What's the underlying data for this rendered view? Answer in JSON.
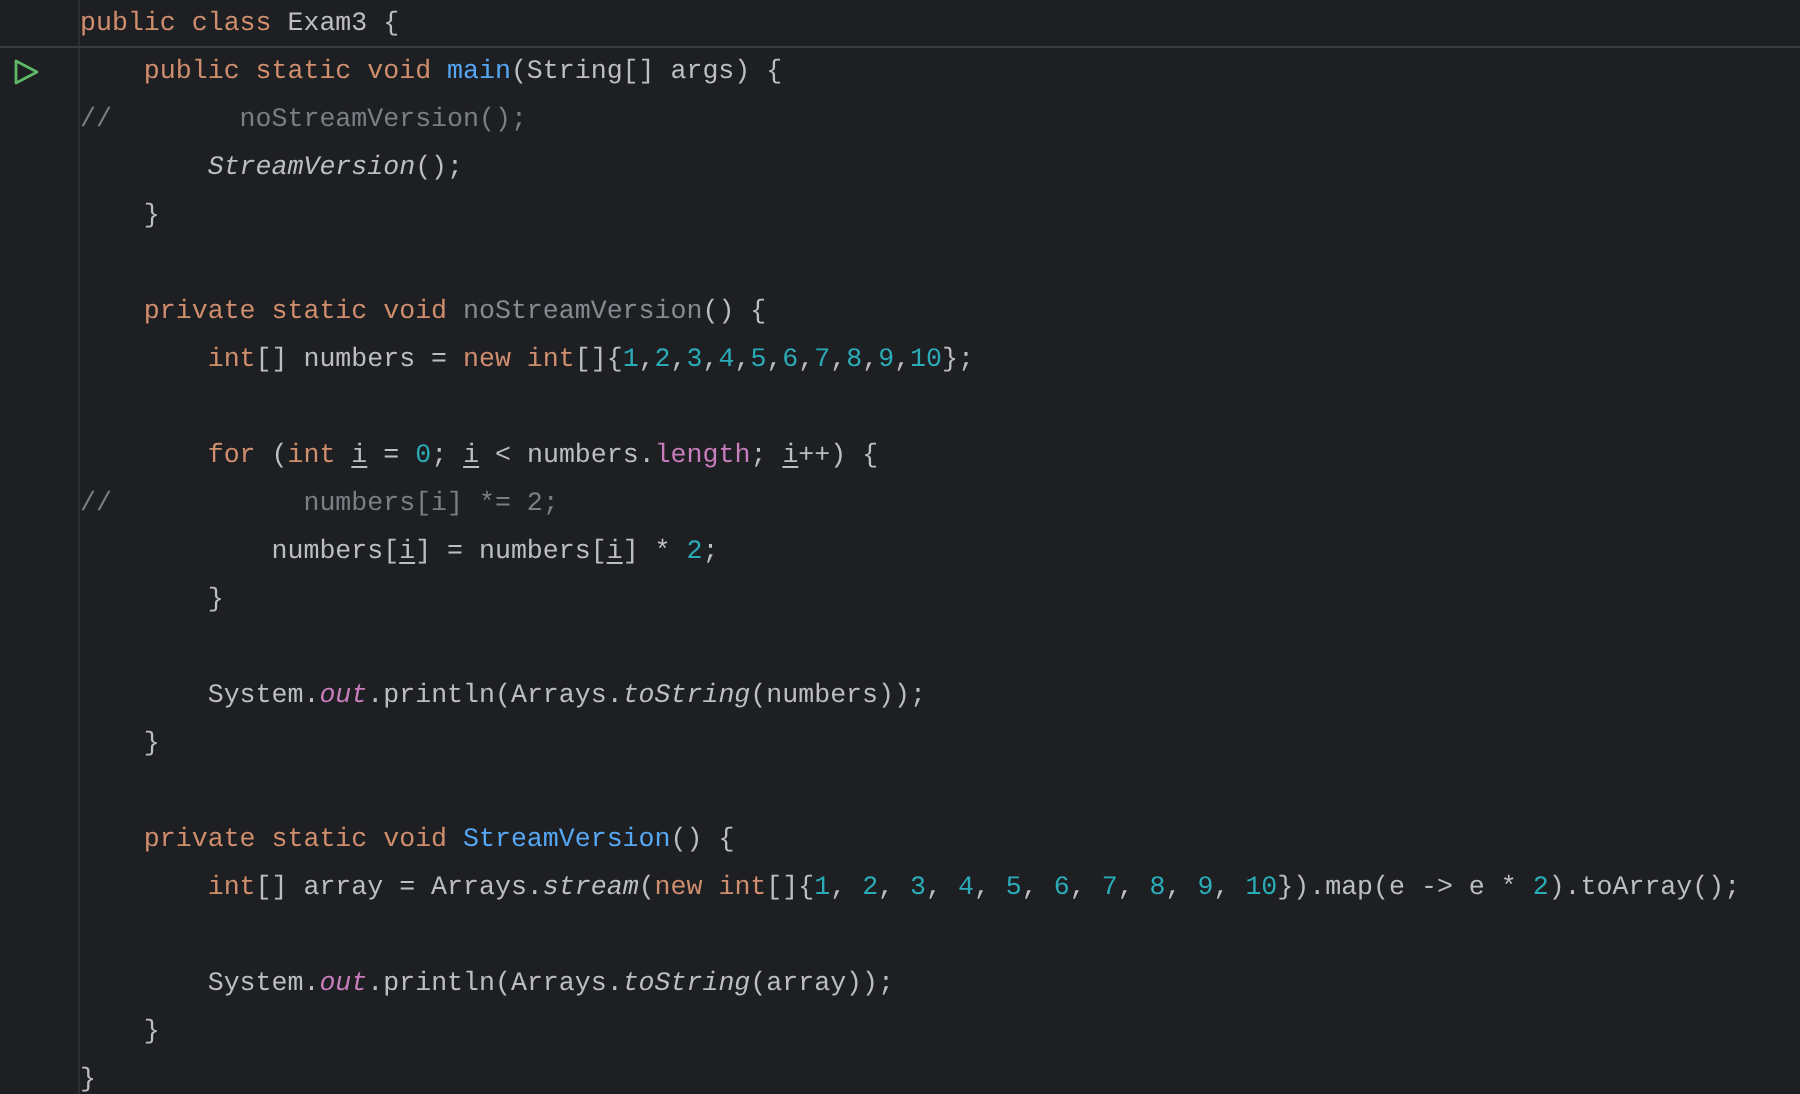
{
  "editor": {
    "lines": [
      {
        "kind": "code",
        "tokens": [
          {
            "kind": "keyword",
            "text": "public class "
          },
          {
            "kind": "plain",
            "text": "Exam3 {"
          }
        ]
      },
      {
        "kind": "code",
        "run_button": true,
        "tokens": [
          {
            "kind": "keyword",
            "text": "    public static void "
          },
          {
            "kind": "method",
            "text": "main"
          },
          {
            "kind": "plain",
            "text": "(String[] args) {"
          }
        ]
      },
      {
        "kind": "code",
        "tokens": [
          {
            "kind": "comment",
            "text": "//        noStreamVersion();"
          }
        ]
      },
      {
        "kind": "code",
        "tokens": [
          {
            "kind": "static_call",
            "text": "        StreamVersion"
          },
          {
            "kind": "plain",
            "text": "();"
          }
        ]
      },
      {
        "kind": "code",
        "tokens": [
          {
            "kind": "plain",
            "text": "    }"
          }
        ]
      },
      {
        "kind": "blank"
      },
      {
        "kind": "code",
        "tokens": [
          {
            "kind": "keyword",
            "text": "    private static void "
          },
          {
            "kind": "unused",
            "text": "noStreamVersion"
          },
          {
            "kind": "plain",
            "text": "() {"
          }
        ]
      },
      {
        "kind": "code",
        "tokens": [
          {
            "kind": "keyword",
            "text": "        int"
          },
          {
            "kind": "plain",
            "text": "[] numbers = "
          },
          {
            "kind": "keyword",
            "text": "new int"
          },
          {
            "kind": "plain",
            "text": "[]{"
          },
          {
            "kind": "number",
            "text": "1"
          },
          {
            "kind": "plain",
            "text": ","
          },
          {
            "kind": "number",
            "text": "2"
          },
          {
            "kind": "plain",
            "text": ","
          },
          {
            "kind": "number",
            "text": "3"
          },
          {
            "kind": "plain",
            "text": ","
          },
          {
            "kind": "number",
            "text": "4"
          },
          {
            "kind": "plain",
            "text": ","
          },
          {
            "kind": "number",
            "text": "5"
          },
          {
            "kind": "plain",
            "text": ","
          },
          {
            "kind": "number",
            "text": "6"
          },
          {
            "kind": "plain",
            "text": ","
          },
          {
            "kind": "number",
            "text": "7"
          },
          {
            "kind": "plain",
            "text": ","
          },
          {
            "kind": "number",
            "text": "8"
          },
          {
            "kind": "plain",
            "text": ","
          },
          {
            "kind": "number",
            "text": "9"
          },
          {
            "kind": "plain",
            "text": ","
          },
          {
            "kind": "number",
            "text": "10"
          },
          {
            "kind": "plain",
            "text": "};"
          }
        ]
      },
      {
        "kind": "blank"
      },
      {
        "kind": "code",
        "tokens": [
          {
            "kind": "keyword",
            "text": "        for "
          },
          {
            "kind": "plain",
            "text": "("
          },
          {
            "kind": "keyword",
            "text": "int "
          },
          {
            "kind": "var",
            "text": "i"
          },
          {
            "kind": "plain",
            "text": " = "
          },
          {
            "kind": "number",
            "text": "0"
          },
          {
            "kind": "plain",
            "text": "; "
          },
          {
            "kind": "var",
            "text": "i"
          },
          {
            "kind": "plain",
            "text": " < numbers."
          },
          {
            "kind": "field",
            "text": "length"
          },
          {
            "kind": "plain",
            "text": "; "
          },
          {
            "kind": "var",
            "text": "i"
          },
          {
            "kind": "plain",
            "text": "++) {"
          }
        ]
      },
      {
        "kind": "code",
        "tokens": [
          {
            "kind": "comment",
            "text": "//            numbers[i] *= 2;"
          }
        ]
      },
      {
        "kind": "code",
        "tokens": [
          {
            "kind": "plain",
            "text": "            numbers["
          },
          {
            "kind": "var",
            "text": "i"
          },
          {
            "kind": "plain",
            "text": "] = numbers["
          },
          {
            "kind": "var",
            "text": "i"
          },
          {
            "kind": "plain",
            "text": "] * "
          },
          {
            "kind": "number",
            "text": "2"
          },
          {
            "kind": "plain",
            "text": ";"
          }
        ]
      },
      {
        "kind": "code",
        "tokens": [
          {
            "kind": "plain",
            "text": "        }"
          }
        ]
      },
      {
        "kind": "blank"
      },
      {
        "kind": "code",
        "tokens": [
          {
            "kind": "plain",
            "text": "        System."
          },
          {
            "kind": "static_field",
            "text": "out"
          },
          {
            "kind": "plain",
            "text": ".println(Arrays."
          },
          {
            "kind": "static_call",
            "text": "toString"
          },
          {
            "kind": "plain",
            "text": "(numbers));"
          }
        ]
      },
      {
        "kind": "code",
        "tokens": [
          {
            "kind": "plain",
            "text": "    }"
          }
        ]
      },
      {
        "kind": "blank"
      },
      {
        "kind": "code",
        "tokens": [
          {
            "kind": "keyword",
            "text": "    private static void "
          },
          {
            "kind": "method",
            "text": "StreamVersion"
          },
          {
            "kind": "plain",
            "text": "() {"
          }
        ]
      },
      {
        "kind": "code",
        "tokens": [
          {
            "kind": "keyword",
            "text": "        int"
          },
          {
            "kind": "plain",
            "text": "[] array = Arrays."
          },
          {
            "kind": "static_call",
            "text": "stream"
          },
          {
            "kind": "plain",
            "text": "("
          },
          {
            "kind": "keyword",
            "text": "new int"
          },
          {
            "kind": "plain",
            "text": "[]{"
          },
          {
            "kind": "number",
            "text": "1"
          },
          {
            "kind": "plain",
            "text": ", "
          },
          {
            "kind": "number",
            "text": "2"
          },
          {
            "kind": "plain",
            "text": ", "
          },
          {
            "kind": "number",
            "text": "3"
          },
          {
            "kind": "plain",
            "text": ", "
          },
          {
            "kind": "number",
            "text": "4"
          },
          {
            "kind": "plain",
            "text": ", "
          },
          {
            "kind": "number",
            "text": "5"
          },
          {
            "kind": "plain",
            "text": ", "
          },
          {
            "kind": "number",
            "text": "6"
          },
          {
            "kind": "plain",
            "text": ", "
          },
          {
            "kind": "number",
            "text": "7"
          },
          {
            "kind": "plain",
            "text": ", "
          },
          {
            "kind": "number",
            "text": "8"
          },
          {
            "kind": "plain",
            "text": ", "
          },
          {
            "kind": "number",
            "text": "9"
          },
          {
            "kind": "plain",
            "text": ", "
          },
          {
            "kind": "number",
            "text": "10"
          },
          {
            "kind": "plain",
            "text": "}).map(e -> e * "
          },
          {
            "kind": "number",
            "text": "2"
          },
          {
            "kind": "plain",
            "text": ").toArray();"
          }
        ]
      },
      {
        "kind": "blank"
      },
      {
        "kind": "code",
        "tokens": [
          {
            "kind": "plain",
            "text": "        System."
          },
          {
            "kind": "static_field",
            "text": "out"
          },
          {
            "kind": "plain",
            "text": ".println(Arrays."
          },
          {
            "kind": "static_call",
            "text": "toString"
          },
          {
            "kind": "plain",
            "text": "(array));"
          }
        ]
      },
      {
        "kind": "code",
        "tokens": [
          {
            "kind": "plain",
            "text": "    }"
          }
        ]
      },
      {
        "kind": "code",
        "tokens": [
          {
            "kind": "plain",
            "text": "}"
          }
        ]
      }
    ]
  }
}
